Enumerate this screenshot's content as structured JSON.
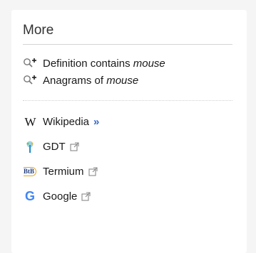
{
  "section": {
    "title": "More"
  },
  "search_links": [
    {
      "prefix": "Definition contains ",
      "term": "mouse"
    },
    {
      "prefix": "Anagrams of ",
      "term": "mouse"
    }
  ],
  "external_links": [
    {
      "label": "Wikipedia",
      "icon": "wikipedia-icon",
      "trailing": "»"
    },
    {
      "label": "GDT",
      "icon": "gdt-icon",
      "trailing": "external-link-icon"
    },
    {
      "label": "Termium",
      "icon": "termium-icon",
      "logo_text": "BtB",
      "trailing": "external-link-icon"
    },
    {
      "label": "Google",
      "icon": "google-icon",
      "logo_text": "G",
      "trailing": "external-link-icon"
    }
  ],
  "colors": {
    "accent": "#3366cc",
    "google_blue": "#4285f4",
    "termium_orange": "#e0a526"
  }
}
